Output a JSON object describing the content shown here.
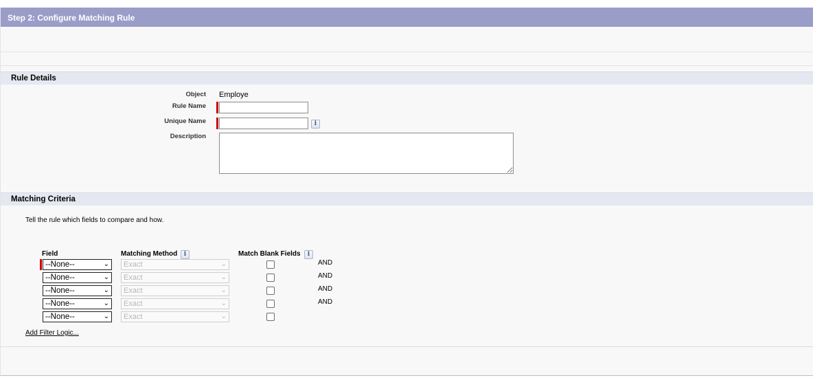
{
  "step_header": {
    "title": "Step 2: Configure Matching Rule"
  },
  "rule_details": {
    "section_title": "Rule Details",
    "object_label": "Object",
    "object_value": "Employe",
    "rule_name_label": "Rule Name",
    "rule_name_value": "",
    "unique_name_label": "Unique Name",
    "unique_name_value": "",
    "description_label": "Description",
    "description_value": ""
  },
  "matching_criteria": {
    "section_title": "Matching Criteria",
    "instructions": "Tell the rule which fields to compare and how.",
    "columns": {
      "field": "Field",
      "method": "Matching Method",
      "blank": "Match Blank Fields"
    },
    "rows": [
      {
        "field": "--None--",
        "method": "Exact",
        "blank_checked": false,
        "connector": "AND",
        "required": true
      },
      {
        "field": "--None--",
        "method": "Exact",
        "blank_checked": false,
        "connector": "AND",
        "required": false
      },
      {
        "field": "--None--",
        "method": "Exact",
        "blank_checked": false,
        "connector": "AND",
        "required": false
      },
      {
        "field": "--None--",
        "method": "Exact",
        "blank_checked": false,
        "connector": "AND",
        "required": false
      },
      {
        "field": "--None--",
        "method": "Exact",
        "blank_checked": false,
        "connector": "",
        "required": false
      }
    ],
    "add_filter_logic": "Add Filter Logic...",
    "info_icon_glyph": "i"
  },
  "colors": {
    "header_bar": "#9a9dc8",
    "section_bar": "#e5e8f1",
    "required": "#cc0000"
  }
}
